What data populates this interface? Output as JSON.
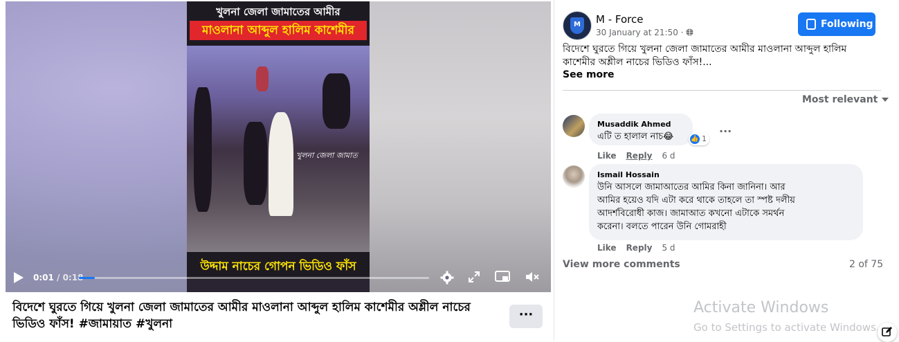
{
  "video": {
    "banner_top_line1": "খুলনা জেলা জামাতের আমীর",
    "banner_top_line2": "মাওলানা আব্দুল হালিম কাশেমীর",
    "overlay_caption": "খুলনা জেলা জামাত",
    "banner_bottom": "উদ্দাম নাচের গোপন ভিডিও ফাঁস",
    "time_current": "0:01",
    "time_sep": " / ",
    "time_total": "0:18",
    "progress_fraction": 0.045,
    "icons": [
      "play-icon",
      "settings-icon",
      "fullscreen-icon",
      "picture-in-picture-icon",
      "mute-icon"
    ]
  },
  "post_title": "বিদেশে ঘুরতে গিয়ে খুলনা জেলা জামাতের আমীর মাওলানা আব্দুল হালিম কাশেমীর অশ্লীল নাচের ভিডিও ফাঁস! #জামায়াত #খুলনা",
  "more_label": "···",
  "page": {
    "name": "M - Force",
    "time": "30 January at 21:50 · ",
    "audience_icon": "globe-icon",
    "follow_label": "Following",
    "post_text": "বিদেশে ঘুরতে গিয়ে খুলনা জেলা জামাতের আমীর মাওলানা আব্দুল হালিম কাশেমীর অশ্লীল নাচের ভিডিও ফাঁস!...",
    "see_more": "See more"
  },
  "comments": {
    "sort_label": "Most relevant",
    "items": [
      {
        "author": "Musaddik Ahmed",
        "text": "এটি ত হালাল নাচ😂",
        "reaction_count": "1",
        "like": "Like",
        "reply": "Reply",
        "age": "6 d"
      },
      {
        "author": "Ismail Hossain",
        "text_lines": [
          "উনি আসলে জামাআতের আমির কিনা জানিনা। আর",
          "আমির হয়েও যদি এটা করে থাকে তাহলে তা স্পষ্ট দলীয়",
          "আদর্শবিরোধী কাজ। জামাআত কখনো এটাকে সমর্থন",
          "করেনা। বলতে পারেন উনি গোমরাহী"
        ],
        "like": "Like",
        "reply": "Reply",
        "age": "5 d"
      }
    ],
    "view_more": "View more comments",
    "count": "2 of 75"
  },
  "watermark": {
    "title": "Activate Windows",
    "subtitle": "Go to Settings to activate Windows."
  },
  "colors": {
    "accent": "#1877f2",
    "banner_red": "#e1262c",
    "banner_yellow": "#ffe600"
  }
}
